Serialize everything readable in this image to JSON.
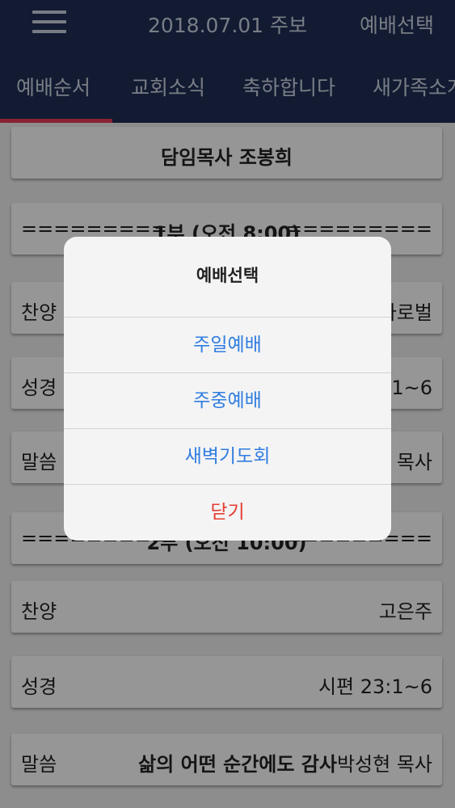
{
  "header": {
    "title": "2018.07.01 주보",
    "action": "예배선택"
  },
  "tabs": [
    "예배순서",
    "교회소식",
    "축하합니다",
    "새가족소개"
  ],
  "cards": {
    "c0": {
      "center": "담임목사 조봉희"
    },
    "c1": {
      "left": "=========",
      "center": "1부 (오전 8:00)",
      "right": "========="
    },
    "c2": {
      "left": "찬양",
      "right": "호산나 성가대 / 로마로벌"
    },
    "c3": {
      "left": "성경",
      "right": "시편 23:1~6"
    },
    "c4": {
      "left": "말씀",
      "right": "박성현 목사"
    },
    "c5": {
      "left": "=========",
      "center": "2부 (오전 10:00)",
      "right": "========="
    },
    "c6": {
      "left": "찬양",
      "right": "고은주"
    },
    "c7": {
      "left": "성경",
      "right": "시편 23:1~6"
    },
    "c8": {
      "left": "말씀",
      "sermon": "삶의 어떤 순간에도 감사",
      "right": "박성현 목사"
    }
  },
  "dialog": {
    "title": "예배선택",
    "options": [
      "주일예배",
      "주중예배",
      "새벽기도회"
    ],
    "close": "닫기"
  }
}
